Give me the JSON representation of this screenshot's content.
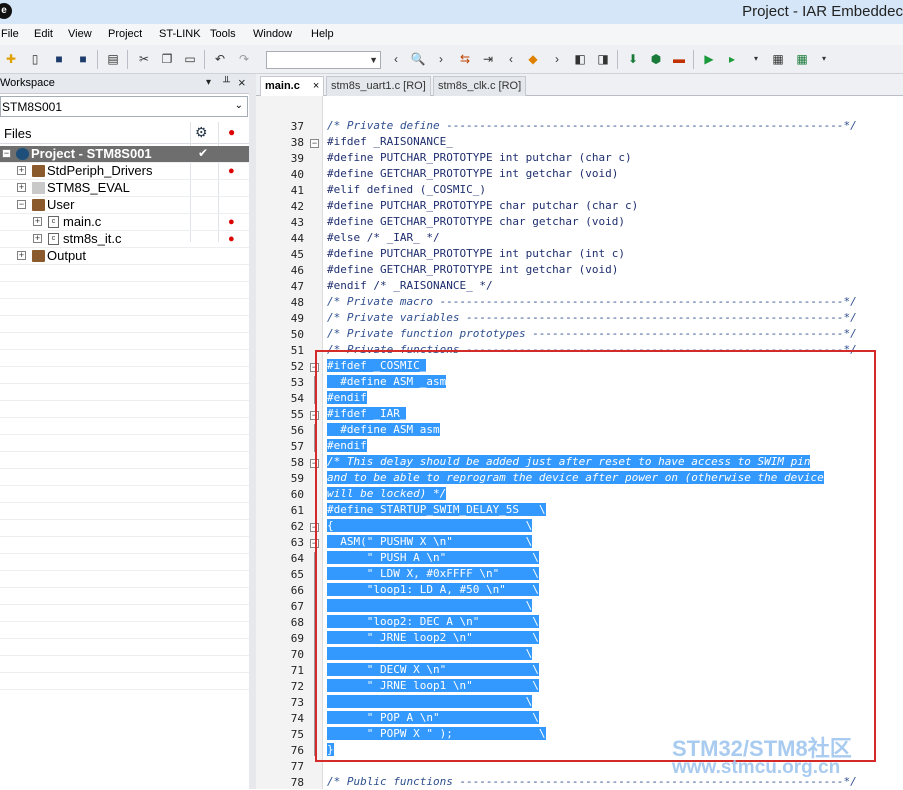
{
  "window": {
    "title": "Project - IAR Embeddec",
    "app_icon": "iar-logo-icon"
  },
  "menu": [
    "File",
    "Edit",
    "View",
    "Project",
    "ST-LINK",
    "Tools",
    "Window",
    "Help"
  ],
  "toolbar": {
    "search_value": ""
  },
  "workspace": {
    "title": "Workspace",
    "pin": "▾",
    "dock": "╨",
    "close": "×",
    "config": "STM8S001",
    "files_label": "Files",
    "tree": [
      {
        "label": "Project - STM8S001",
        "type": "project",
        "check": "✔",
        "dot": false
      },
      {
        "label": "StdPeriph_Drivers",
        "type": "folder",
        "dot": true
      },
      {
        "label": "STM8S_EVAL",
        "type": "folder-grey",
        "dot": false
      },
      {
        "label": "User",
        "type": "folder",
        "dot": false
      },
      {
        "label": "main.c",
        "type": "cfile",
        "dot": true
      },
      {
        "label": "stm8s_it.c",
        "type": "cfile",
        "dot": true
      },
      {
        "label": "Output",
        "type": "folder",
        "dot": false
      }
    ]
  },
  "tabs": [
    {
      "label": "main.c",
      "active": true,
      "close": "×"
    },
    {
      "label": "stm8s_uart1.c [RO]",
      "active": false
    },
    {
      "label": "stm8s_clk.c [RO]",
      "active": false
    }
  ],
  "code": {
    "lines": [
      {
        "n": "37",
        "t": "/* Private define ------------------------------------------------------------*/"
      },
      {
        "n": "38",
        "t": "#ifdef _RAISONANCE_"
      },
      {
        "n": "39",
        "t": "#define PUTCHAR_PROTOTYPE int putchar (char c)"
      },
      {
        "n": "40",
        "t": "#define GETCHAR_PROTOTYPE int getchar (void)"
      },
      {
        "n": "41",
        "t": "#elif defined (_COSMIC_)"
      },
      {
        "n": "42",
        "t": "#define PUTCHAR_PROTOTYPE char putchar (char c)"
      },
      {
        "n": "43",
        "t": "#define GETCHAR_PROTOTYPE char getchar (void)"
      },
      {
        "n": "44",
        "t": "#else /* _IAR_ */"
      },
      {
        "n": "45",
        "t": "#define PUTCHAR_PROTOTYPE int putchar (int c)"
      },
      {
        "n": "46",
        "t": "#define GETCHAR_PROTOTYPE int getchar (void)"
      },
      {
        "n": "47",
        "t": "#endif /* _RAISONANCE_ */"
      },
      {
        "n": "48",
        "t": "/* Private macro -------------------------------------------------------------*/"
      },
      {
        "n": "49",
        "t": "/* Private variables ---------------------------------------------------------*/"
      },
      {
        "n": "50",
        "t": "/* Private function prototypes -----------------------------------------------*/"
      },
      {
        "n": "51",
        "t": "/* Private functions ---------------------------------------------------------*/"
      },
      {
        "n": "52",
        "t": "#ifdef _COSMIC_"
      },
      {
        "n": "53",
        "t": "  #define ASM _asm"
      },
      {
        "n": "54",
        "t": "#endif"
      },
      {
        "n": "55",
        "t": "#ifdef _IAR_"
      },
      {
        "n": "56",
        "t": "  #define ASM asm"
      },
      {
        "n": "57",
        "t": "#endif"
      },
      {
        "n": "58",
        "t": "/* This delay should be added just after reset to have access to SWIM pin"
      },
      {
        "n": "59",
        "t": "and to be able to reprogram the device after power on (otherwise the device"
      },
      {
        "n": "60",
        "t": "will be locked) */"
      },
      {
        "n": "61",
        "t": "#define STARTUP_SWIM_DELAY_5S   \\"
      },
      {
        "n": "62",
        "t": "{                             \\"
      },
      {
        "n": "63",
        "t": "  ASM(\" PUSHW X \\n\"           \\"
      },
      {
        "n": "64",
        "t": "      \" PUSH A \\n\"             \\"
      },
      {
        "n": "65",
        "t": "      \" LDW X, #0xFFFF \\n\"     \\"
      },
      {
        "n": "66",
        "t": "      \"loop1: LD A, #50 \\n\"    \\"
      },
      {
        "n": "67",
        "t": "                              \\"
      },
      {
        "n": "68",
        "t": "      \"loop2: DEC A \\n\"        \\"
      },
      {
        "n": "69",
        "t": "      \" JRNE loop2 \\n\"         \\"
      },
      {
        "n": "70",
        "t": "                              \\"
      },
      {
        "n": "71",
        "t": "      \" DECW X \\n\"             \\"
      },
      {
        "n": "72",
        "t": "      \" JRNE loop1 \\n\"         \\"
      },
      {
        "n": "73",
        "t": "                              \\"
      },
      {
        "n": "74",
        "t": "      \" POP A \\n\"              \\"
      },
      {
        "n": "75",
        "t": "      \" POPW X \" );             \\"
      },
      {
        "n": "76",
        "t": "}"
      },
      {
        "n": "77",
        "t": ""
      },
      {
        "n": "78",
        "t": "/* Public functions ----------------------------------------------------------*/"
      }
    ]
  },
  "watermark": {
    "line1": "STM32/STM8社区",
    "line2": "www.stmcu.org.cn"
  },
  "colors": {
    "selection": "#3399ff",
    "highlight_box": "#d42a2a",
    "title_bar": "#d4e6f7"
  }
}
